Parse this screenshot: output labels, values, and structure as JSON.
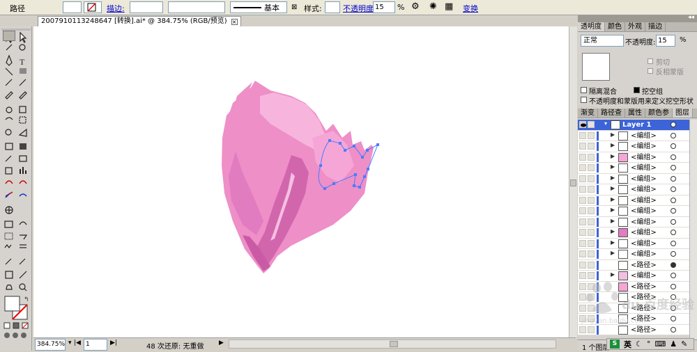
{
  "control_bar": {
    "object_type": "路径",
    "stroke_label": "描边:",
    "stroke_profile": "基本",
    "style_label": "样式:",
    "opacity_label": "不透明度:",
    "opacity_value": "15",
    "percent": "%",
    "transform_label": "变换"
  },
  "document": {
    "tab_title": "2007910113248647 [转换].ai* @ 384.75% (RGB/预览)"
  },
  "status_bar": {
    "zoom": "384.75%",
    "artboard": "1",
    "undo_status": "48 次还原: 无重做"
  },
  "transparency_panel": {
    "tabs": [
      "透明度",
      "颜色",
      "外观",
      "描边"
    ],
    "blend_mode": "正常",
    "opacity_label": "不透明度:",
    "opacity_value": "15",
    "percent": "%",
    "clip_label": "剪切",
    "invert_mask_label": "反相蒙版",
    "isolate_blending_label": "隔离混合",
    "knockout_group_label": "挖空组",
    "opacity_mask_define_label": "不透明度和蒙版用来定义挖空形状"
  },
  "layers_panel": {
    "tabs": [
      "渐变",
      "路径查",
      "属性",
      "颜色参",
      "图层"
    ],
    "layer_name": "Layer 1",
    "items": [
      "<编组>",
      "<编组>",
      "<编组>",
      "<编组>",
      "<编组>",
      "<编组>",
      "<编组>",
      "<编组>",
      "<编组>",
      "<编组>",
      "<编组>",
      "<编组>",
      "<路径>",
      "<编组>",
      "<路径>",
      "<路径>",
      "<路径>",
      "<路径>",
      "<路径>"
    ],
    "footer_text": "1 个图层"
  },
  "taskbar": {
    "ime_label": "英"
  },
  "watermark": {
    "text": "du 百度经验",
    "url": "jingyan.baidu.com"
  },
  "colors": {
    "petal_base": "#ee8fc8",
    "petal_light": "#f7b5dd",
    "petal_dark": "#d266ad",
    "path_selection": "#4a7bff",
    "layer_color_bar": "#3d63d8"
  }
}
